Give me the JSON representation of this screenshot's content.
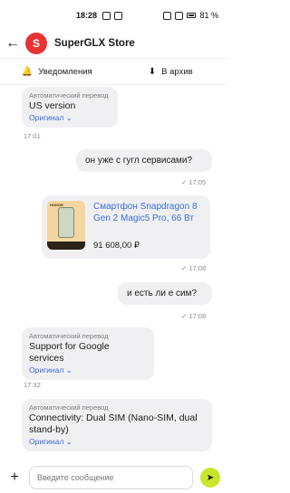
{
  "statusbar": {
    "time": "18:28",
    "battery": "81 %"
  },
  "header": {
    "back_icon": "←",
    "logo_text": "S",
    "title": "SuperGLX Store"
  },
  "actions": [
    {
      "icon": "bell-icon",
      "glyph": "🔔",
      "label": "Уведомления"
    },
    {
      "icon": "archive-icon",
      "glyph": "⬇",
      "label": "В архив"
    }
  ],
  "messages": {
    "m1": {
      "auto": "Автоматический перевод",
      "text": "US version",
      "orig": "Оригинал ⌄",
      "time": "17:01"
    },
    "m2": {
      "text": "он уже с гугл сервисами?",
      "time": "✓ 17:05"
    },
    "card": {
      "brand": "HONOR",
      "title": "Смартфон Snapdragon 8 Gen 2 Magic5 Pro, 66 Вт",
      "price": "91 608,00 ₽",
      "time": "✓ 17:08"
    },
    "m3": {
      "text": "и есть ли е сим?",
      "time": "✓ 17:08"
    },
    "m4": {
      "auto": "Автоматический перевод",
      "text": "Support for Google services",
      "orig": "Оригинал ⌄",
      "time": "17:32"
    },
    "m5": {
      "auto": "Автоматический перевод",
      "text": "Connectivity: Dual SIM (Nano-SIM, dual stand-by)",
      "orig": "Оригинал ⌄"
    }
  },
  "composer": {
    "placeholder": "Введите сообщение",
    "plus": "+",
    "send": "➤"
  }
}
